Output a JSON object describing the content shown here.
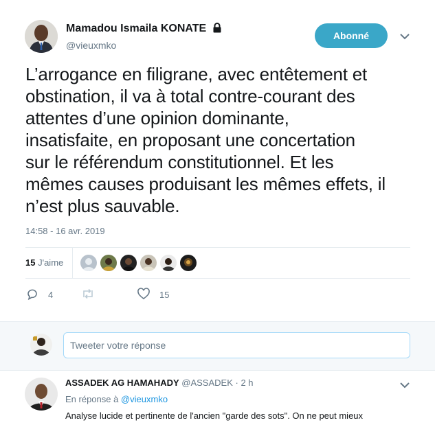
{
  "tweet": {
    "author_name": "Mamadou Ismaila KONATE",
    "author_handle": "@vieuxmko",
    "follow_label": "Abonné",
    "text_lines": [
      "L’arrogance en filigrane, avec entêtement et",
      "obstination, il va à total contre-courant des",
      "attentes d’une opinion dominante,",
      "insatisfaite, en proposant une concertation",
      "sur le référendum constitutionnel. Et les",
      "mêmes causes produisant les mêmes effets, il",
      "n’est plus sauvable."
    ],
    "timestamp": "14:58 - 16 avr. 2019",
    "likes_count": "15",
    "likes_label": "J'aime",
    "reply_count": "4",
    "retweet_count": "",
    "like_action_count": "15"
  },
  "reply_box": {
    "placeholder": "Tweeter votre réponse"
  },
  "reply": {
    "author_name": "ASSADEK AG HAMAHADY",
    "author_handle": "@ASSADEK",
    "time": "· 2 h",
    "in_reply_prefix": "En réponse à",
    "in_reply_handle": "@vieuxmko",
    "text": "Analyse lucide et pertinente de l'ancien \"garde des sots\". On ne peut mieux"
  },
  "colors": {
    "follow_button": "#3aa7c8",
    "link": "#1b95e0",
    "muted": "#657786"
  },
  "icons": [
    "lock-icon",
    "chevron-down-icon",
    "reply-icon",
    "retweet-icon",
    "heart-icon"
  ]
}
